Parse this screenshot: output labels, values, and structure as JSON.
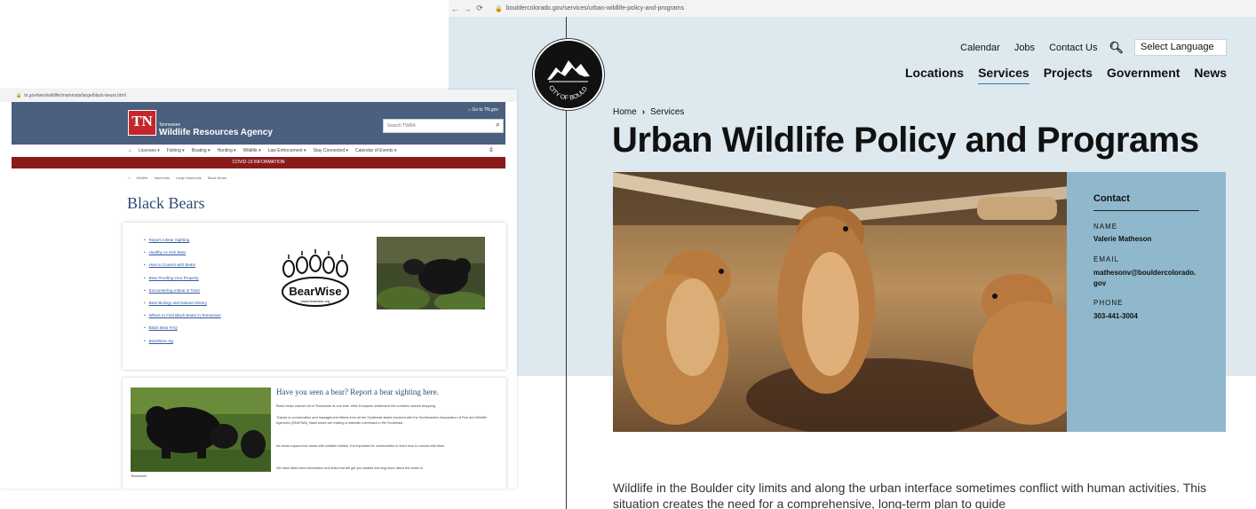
{
  "boulder": {
    "url": "bouldercolorado.gov/services/urban-wildlife-policy-and-programs",
    "logo_text": "CITY OF BOULDER",
    "utility_nav": [
      "Calendar",
      "Jobs",
      "Contact Us"
    ],
    "language_select": "Select Language",
    "main_nav": [
      "Locations",
      "Services",
      "Projects",
      "Government",
      "News"
    ],
    "active_nav": "Services",
    "breadcrumb": [
      "Home",
      "Services"
    ],
    "page_title": "Urban Wildlife Policy and Programs",
    "contact": {
      "heading": "Contact",
      "name_label": "NAME",
      "name": "Valerie Matheson",
      "email_label": "EMAIL",
      "email_line1": "mathesonv@bouldercolorado.",
      "email_line2": "gov",
      "phone_label": "PHONE",
      "phone": "303-441-3004"
    },
    "body_text": "Wildlife in the Boulder city limits and along the urban interface sometimes conflict with human activities. This situation creates the need for a comprehensive, long-term plan to guide"
  },
  "twra": {
    "url": "tn.gov/twra/wildlife/mammals/large/black-bears.html",
    "logo": "TN",
    "state": "Tennessee",
    "agency": "Wildlife Resources Agency",
    "login": "Go to TN.gov",
    "search_placeholder": "Search TWRA",
    "nav": [
      "Licenses ▾",
      "Fishing ▾",
      "Boating ▾",
      "Hunting ▾",
      "Wildlife ▾",
      "Law Enforcement ▾",
      "Stay Connected ▾",
      "Calendar of Events ▾"
    ],
    "covid": "COVID-19 INFORMATION",
    "breadcrumb": [
      "Wildlife",
      "Mammals",
      "Large Mammals",
      "Black Bears"
    ],
    "title": "Black Bears",
    "links": [
      "Report a Bear Sighting",
      "Healthy vs Sick Bear",
      "How to Coexist with Bears",
      "Bear Proofing Your Property",
      "Encountering a Bear in Town",
      "Bear Biology and Natural History",
      "Where to Find Black Bears in Tennessee",
      "Black Bear FAQ",
      "BearWise.org"
    ],
    "bearwise": "BearWise",
    "bearwise_url": "www.bearwise.org",
    "sighting_title": "Have you seen a bear? Report a bear sighting here.",
    "paragraphs": [
      "Black bears roamed all of Tennessee at one time. After European settlement the numbers started dropping.",
      "Thanks to conservation and management efforts from all the Southeast states involved with the Southeastern Association of Fish and Wildlife Agencies (SEAFWA), black bears are making a dramatic comeback in the Southeast.",
      "As bears expand into areas with suitable habitat, it is important for communities to learn how to coexist with them.",
      "We have listed here information and links that will get you started learning more about the bears in"
    ],
    "tail": "Tennessee."
  }
}
